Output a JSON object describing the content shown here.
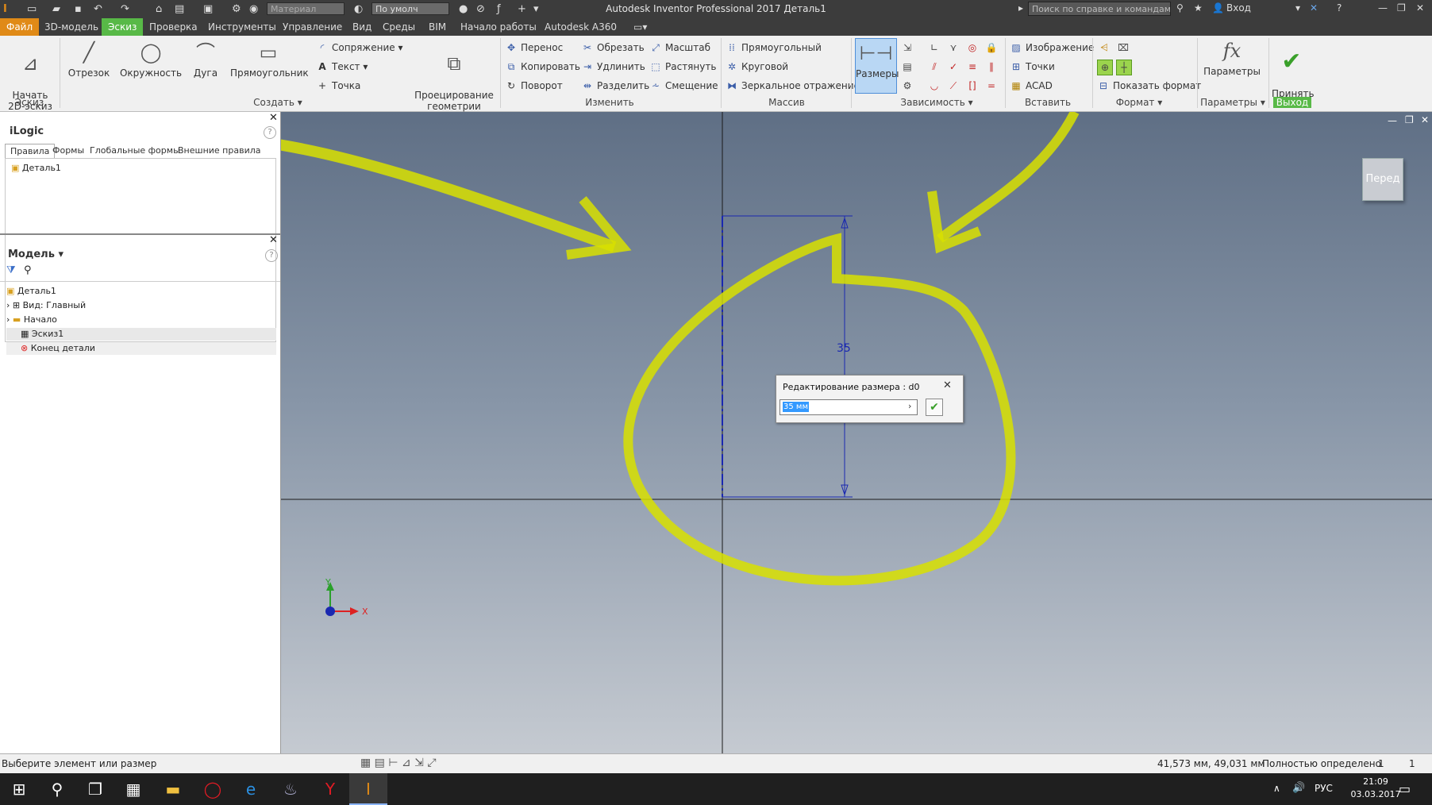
{
  "window": {
    "title": "Autodesk Inventor Professional 2017   Деталь1",
    "material_placeholder": "Материал",
    "appearance": "По умолч",
    "search_placeholder": "Поиск по справке и командам",
    "login": "Вход"
  },
  "menu": [
    "Файл",
    "3D-модель",
    "Эскиз",
    "Проверка",
    "Инструменты",
    "Управление",
    "Вид",
    "Среды",
    "BIM",
    "Начало работы",
    "Autodesk A360"
  ],
  "ribbon": {
    "sketch_group": {
      "start_label": "Начать\n2D-эскиз",
      "label": "Эскиз"
    },
    "create_group": {
      "line": "Отрезок",
      "circle": "Окружность",
      "arc": "Дуга",
      "rectangle": "Прямоугольник",
      "fillet": "Сопряжение",
      "text": "Текст",
      "point": "Точка",
      "project": "Проецирование\nгеометрии",
      "label": "Создать"
    },
    "modify_group": {
      "move": "Перенос",
      "copy": "Копировать",
      "rotate": "Поворот",
      "trim": "Обрезать",
      "extend": "Удлинить",
      "split": "Разделить",
      "scale": "Масштаб",
      "stretch": "Растянуть",
      "offset": "Смещение",
      "label": "Изменить"
    },
    "pattern_group": {
      "rect": "Прямоугольный",
      "circular": "Круговой",
      "mirror": "Зеркальное отражение",
      "label": "Массив"
    },
    "constrain_group": {
      "dimension": "Размеры",
      "label": "Зависимость"
    },
    "insert_group": {
      "image": "Изображение",
      "points": "Точки",
      "acad": "ACAD",
      "label": "Вставить"
    },
    "format_group": {
      "show_format": "Показать формат",
      "label": "Формат"
    },
    "params_group": {
      "params": "Параметры",
      "label": "Параметры"
    },
    "exit_group": {
      "finish": "Принять\nэскиз",
      "label": "Выход"
    }
  },
  "ilogic": {
    "title": "iLogic",
    "tabs": [
      "Правила",
      "Формы",
      "Глобальные формы",
      "Внешние правила"
    ],
    "items": [
      "Деталь1"
    ]
  },
  "model": {
    "title": "Модель",
    "items": [
      "Деталь1",
      "Вид: Главный",
      "Начало",
      "Эскиз1",
      "Конец детали"
    ]
  },
  "viewport": {
    "viewcube": "Перед",
    "dimension_value": "35",
    "axis_x": "X",
    "axis_y": "Y"
  },
  "dialog": {
    "title": "Редактирование размера : d0",
    "value": "35 мм"
  },
  "status": {
    "message": "Выберите элемент или размер",
    "coords": "41,573 мм, 49,031 мм",
    "state": "Полностью определено",
    "count1": "1",
    "count2": "1"
  },
  "taskbar": {
    "lang": "РУС",
    "time": "21:09",
    "date": "03.03.2017"
  },
  "colors": {
    "accent_green": "#58b947",
    "file_orange": "#e08a17",
    "highlight": "#e6f000"
  }
}
